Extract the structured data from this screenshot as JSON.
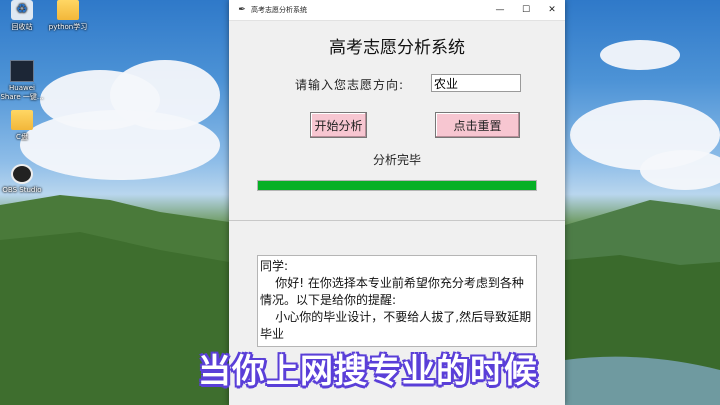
{
  "desktop": {
    "icons": [
      {
        "label": "回收站",
        "icon": "recycle-bin-icon"
      },
      {
        "label": "python学习",
        "icon": "folder-icon"
      },
      {
        "label": "Huawei Share 一键...",
        "icon": "video-file-icon"
      },
      {
        "label": "C盘",
        "icon": "folder-icon"
      },
      {
        "label": "OBS Studio",
        "icon": "obs-icon"
      }
    ]
  },
  "window": {
    "title": "高考志愿分析系统",
    "controls": {
      "minimize": "—",
      "maximize": "☐",
      "close": "✕"
    }
  },
  "app": {
    "heading": "高考志愿分析系统",
    "prompt_label": "请输入您志愿方向:",
    "direction_value": "农业",
    "start_button": "开始分析",
    "reset_button": "点击重置",
    "status": "分析完毕",
    "progress_percent": 100,
    "progress_color": "#06b025",
    "advice_text": "同学:\n    你好! 在你选择本专业前希望你充分考虑到各种情况。以下是给你的提醒:\n    小心你的毕业设计，不要给人拔了,然后导致延期毕业"
  },
  "subtitle": "当你上网搜专业的时候"
}
